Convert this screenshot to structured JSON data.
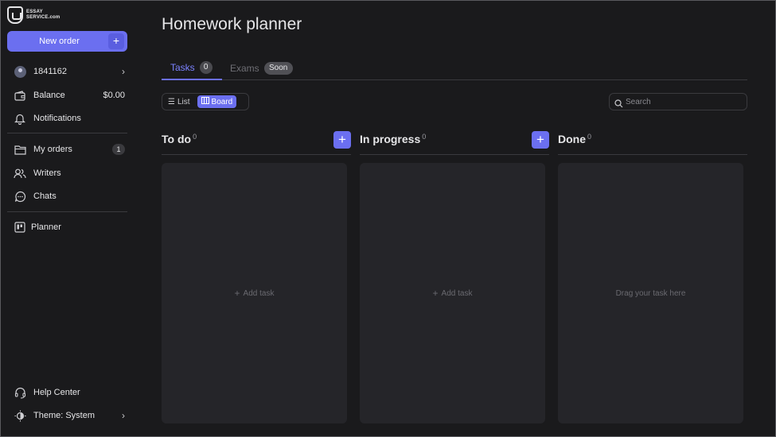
{
  "brand": {
    "logo_line1": "ESSAY",
    "logo_line2": "SERVICE.com"
  },
  "sidebar": {
    "new_order_label": "New order",
    "new_order_icon": "+",
    "account": {
      "id": "1841162"
    },
    "balance": {
      "label": "Balance",
      "value": "$0.00"
    },
    "notifications": {
      "label": "Notifications"
    },
    "my_orders": {
      "label": "My orders",
      "count": "1"
    },
    "writers": {
      "label": "Writers"
    },
    "chats": {
      "label": "Chats"
    },
    "planner": {
      "label": "Planner"
    },
    "help": {
      "label": "Help Center"
    },
    "theme": {
      "label": "Theme: System"
    }
  },
  "main": {
    "title": "Homework planner",
    "tabs": [
      {
        "label": "Tasks",
        "badge": "0"
      },
      {
        "label": "Exams",
        "badge": "Soon"
      }
    ],
    "view_toggle": {
      "list_label": "List",
      "board_label": "Board",
      "active": "Board"
    },
    "search": {
      "placeholder": "Search",
      "value": ""
    },
    "columns": [
      {
        "title": "To do",
        "count": "0",
        "body_text": "Add task",
        "has_add": true
      },
      {
        "title": "In progress",
        "count": "0",
        "body_text": "Add task",
        "has_add": true
      },
      {
        "title": "Done",
        "count": "0",
        "body_text": "Drag your task here",
        "has_add": false
      }
    ]
  },
  "colors": {
    "background": "#1a1a1c",
    "accent": "#6b6ff0",
    "column_bg": "#252529",
    "text": "#e6e6e8",
    "muted": "#6a6a70"
  },
  "icons": {
    "account": "user-avatar-icon",
    "balance": "wallet-icon",
    "notifications": "bell-icon",
    "my_orders": "folder-icon",
    "writers": "users-icon",
    "chats": "chat-bubble-icon",
    "planner": "planner-board-icon",
    "help": "headset-icon",
    "theme": "contrast-icon",
    "search": "search-icon"
  }
}
